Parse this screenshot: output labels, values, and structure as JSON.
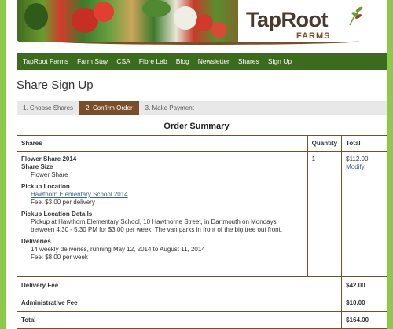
{
  "brand": {
    "name": "TapRoot",
    "sub": "FARMS"
  },
  "nav": [
    "TapRoot Farms",
    "Farm Stay",
    "CSA",
    "Fibre Lab",
    "Blog",
    "Newsletter",
    "Shares",
    "Sign Up"
  ],
  "page_title": "Share Sign Up",
  "steps": [
    "1.  Choose Shares",
    "2.  Confirm Order",
    "3.  Make Payment"
  ],
  "summary_title": "Order Summary",
  "table": {
    "headers": {
      "shares": "Shares",
      "quantity": "Quantity",
      "total": "Total"
    },
    "item": {
      "name": "Flower Share 2014",
      "size_label": "Share Size",
      "size_value": "Flower Share",
      "pickup_label": "Pickup Location",
      "pickup_link": "Hawthorn Elementary School 2014",
      "pickup_fee": "Fee: $3.00 per delivery",
      "details_label": "Pickup Location Details",
      "details_line1": "Pickup at Hawthorn Elementary School, 10 Hawthorne Street, in Dartmouth on Mondays",
      "details_line2": "between 4:30 - 5:30 PM for $3.00 per week.  The van parks in front of the big tree out front.",
      "deliveries_label": "Deliveries",
      "deliveries_line1": "14 weekly deliveries, running May 12, 2014 to August 11, 2014",
      "deliveries_fee": "Fee: $8.00 per week",
      "quantity": "1",
      "total": "$112.00",
      "modify": "Modify"
    },
    "fees": [
      {
        "label": "Delivery Fee",
        "value": "$42.00"
      },
      {
        "label": "Administrative Fee",
        "value": "$10.00"
      },
      {
        "label": "Total",
        "value": "$164.00"
      }
    ]
  },
  "colors": {
    "nav_bg": "#3d6b1e",
    "accent_brown": "#7a4e2a",
    "page_border": "#8cc84b",
    "link": "#3c5f9e"
  }
}
